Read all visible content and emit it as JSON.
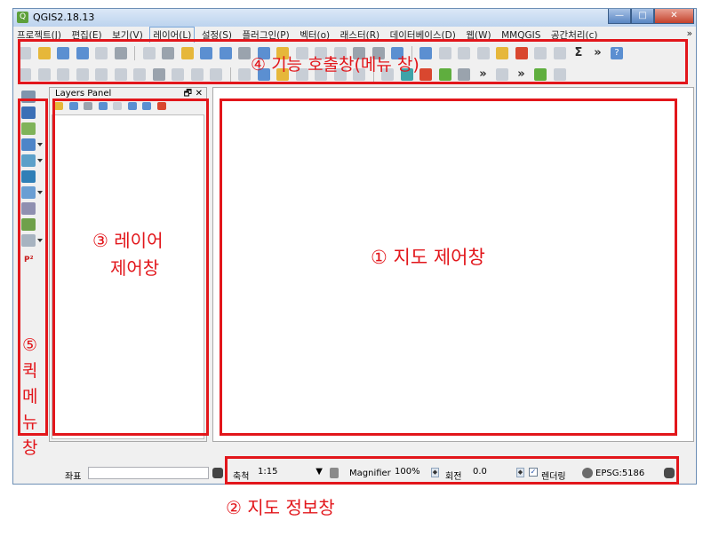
{
  "window": {
    "title": "QGIS2.18.13",
    "minimize": "—",
    "maximize": "□",
    "close": "✕"
  },
  "menu": {
    "items": [
      "프로젝트(J)",
      "편집(E)",
      "보기(V)",
      "레이어(L)",
      "설정(S)",
      "플러그인(P)",
      "벡터(o)",
      "래스터(R)",
      "데이터베이스(D)",
      "웹(W)",
      "MMQGIS",
      "공간처리(c)"
    ],
    "more": "»"
  },
  "toolbar": {
    "sigma": "Σ",
    "more": "»",
    "help": "?"
  },
  "quickbar": {
    "p2_label": "P²"
  },
  "layers_panel": {
    "title": "Layers Panel",
    "float_icon": "🗗",
    "close_icon": "✕"
  },
  "statusbar": {
    "coordinate_label": "좌표",
    "coordinate_value": "",
    "scale_label": "축척",
    "scale_value": "1:15",
    "magnifier_label": "Magnifier",
    "magnifier_value": "100%",
    "rotation_label": "회전",
    "rotation_value": "0.0",
    "render_label": "렌더링",
    "render_checked": true,
    "crs_label": "EPSG:5186"
  },
  "annotations": {
    "map_canvas": "① 지도 제어창",
    "map_info": "② 지도 정보창",
    "layer_control_line1": "③ 레이어",
    "layer_control_line2": "제어창",
    "function_call": "④ 기능 호출창(메뉴 창)",
    "quick_menu_num": "⑤",
    "quick_menu_chars": [
      "퀵",
      "메",
      "뉴",
      "창"
    ]
  },
  "colors": {
    "annotation_red": "#e2161b",
    "title_bar": "#bcd3ee",
    "window_bg": "#f0f0f0"
  }
}
